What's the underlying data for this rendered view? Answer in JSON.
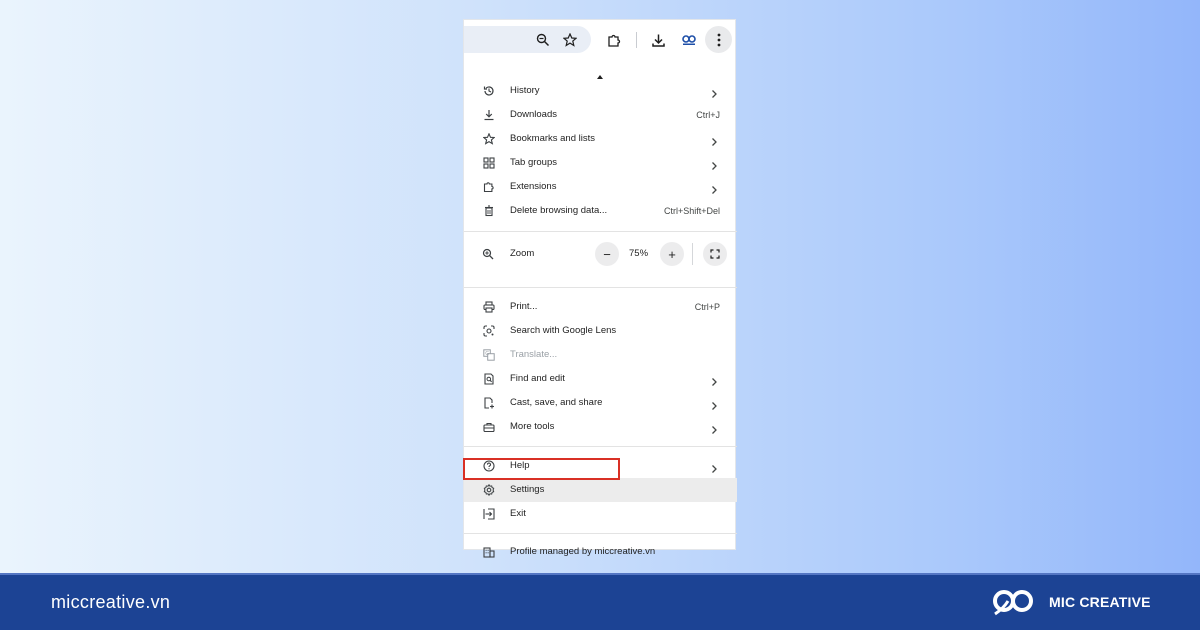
{
  "toolbar": {
    "icons": [
      "zoom-icon",
      "bookmark-star-icon",
      "extensions-icon",
      "download-icon",
      "profile-logo-icon",
      "more-menu-icon"
    ],
    "profile_logo_text": "MIC CREATIVE"
  },
  "menu": {
    "items": [
      {
        "label": "History",
        "icon": "history-icon",
        "submenu": true
      },
      {
        "label": "Downloads",
        "icon": "download-icon",
        "shortcut": "Ctrl+J"
      },
      {
        "label": "Bookmarks and lists",
        "icon": "star-icon",
        "submenu": true
      },
      {
        "label": "Tab groups",
        "icon": "tab-groups-icon",
        "submenu": true
      },
      {
        "label": "Extensions",
        "icon": "extensions-icon",
        "submenu": true
      },
      {
        "label": "Delete browsing data...",
        "icon": "trash-icon",
        "shortcut": "Ctrl+Shift+Del"
      }
    ],
    "zoom": {
      "label": "Zoom",
      "value": "75%",
      "minus": "−",
      "plus": "+"
    },
    "tools": [
      {
        "label": "Print...",
        "icon": "print-icon",
        "shortcut": "Ctrl+P"
      },
      {
        "label": "Search with Google Lens",
        "icon": "google-lens-icon"
      },
      {
        "label": "Translate...",
        "icon": "translate-icon",
        "disabled": true
      },
      {
        "label": "Find and edit",
        "icon": "find-edit-icon",
        "submenu": true
      },
      {
        "label": "Cast, save, and share",
        "icon": "cast-save-share-icon",
        "submenu": true
      },
      {
        "label": "More tools",
        "icon": "toolbox-icon",
        "submenu": true
      }
    ],
    "bottom": [
      {
        "label": "Help",
        "icon": "help-icon",
        "submenu": true
      },
      {
        "label": "Settings",
        "icon": "gear-icon",
        "highlighted": true
      },
      {
        "label": "Exit",
        "icon": "exit-icon"
      }
    ],
    "profile": {
      "label": "Profile managed by miccreative.vn",
      "icon": "building-icon"
    }
  },
  "highlight_color": "#d93025",
  "footer": {
    "website": "miccreative.vn",
    "brand": "MIC CREATIVE",
    "background": "#1c4394"
  }
}
